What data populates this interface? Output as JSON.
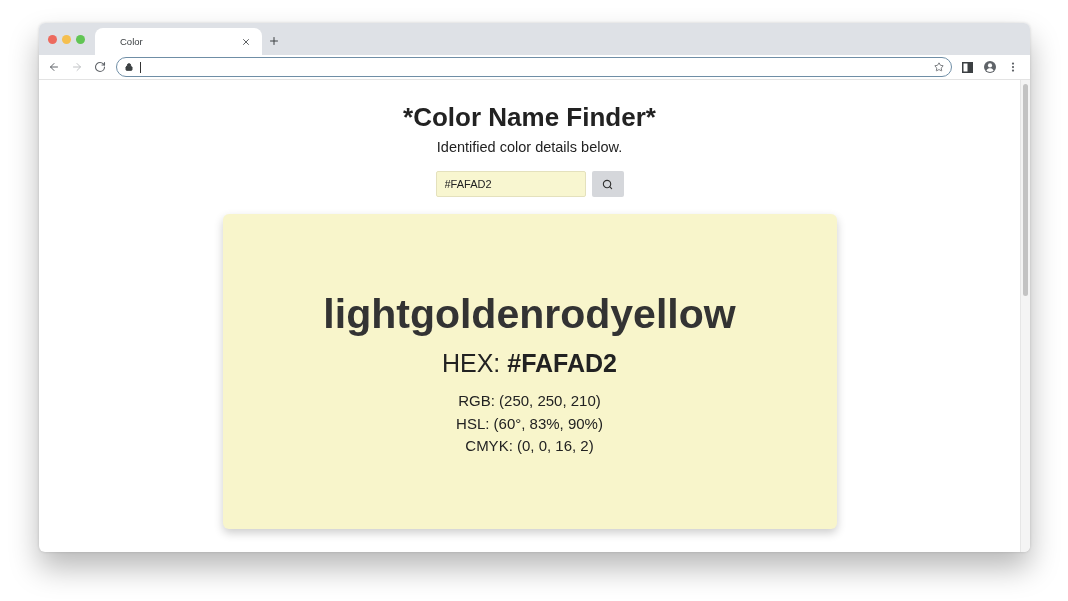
{
  "browser": {
    "tabs": [
      {
        "title": "Color",
        "selected": true
      }
    ],
    "navigation": {
      "back_disabled": false,
      "forward_disabled": true
    },
    "address_bar": {
      "focused": true
    }
  },
  "page": {
    "title": "*Color Name Finder*",
    "subtitle": "Identified color details below.",
    "search": {
      "value": "#FAFAD2"
    },
    "result": {
      "name": "lightgoldenrodyellow",
      "hex_line": "HEX: **#FAFAD2**",
      "details": [
        "RGB: (250, 250, 210)",
        "HSL: (60°, 83%, 90%)",
        "CMYK: (0, 0, 16, 2)"
      ]
    }
  }
}
